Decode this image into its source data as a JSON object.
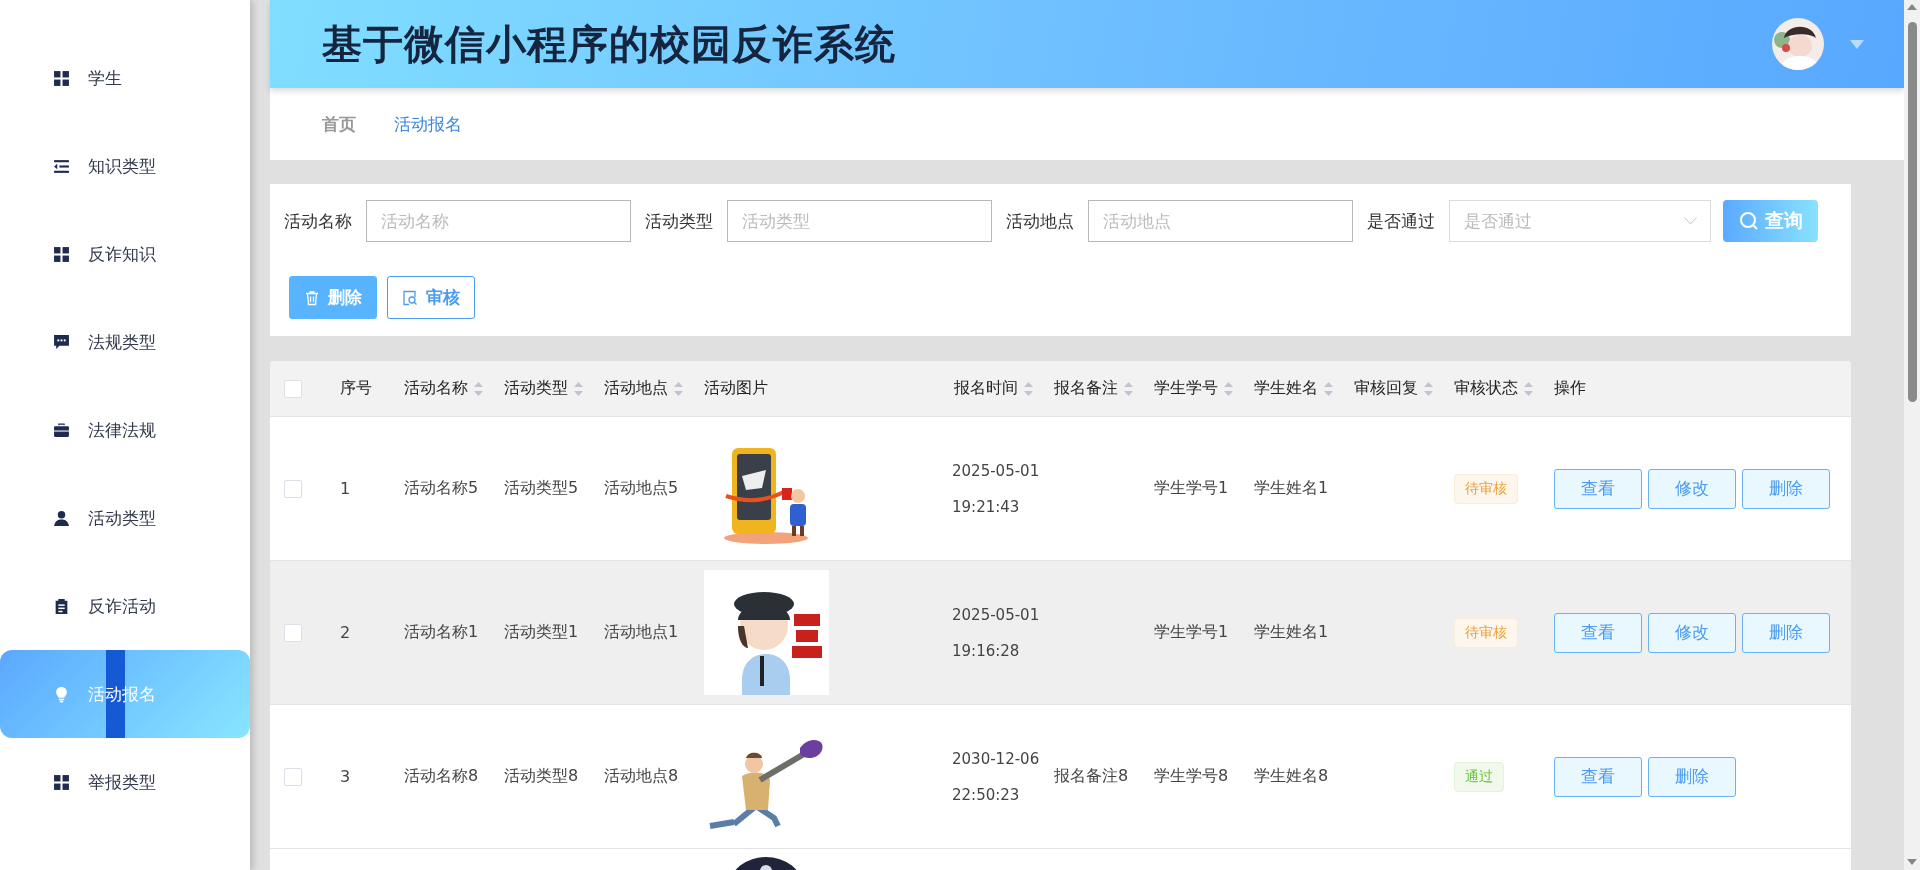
{
  "sidebar": {
    "items": [
      {
        "label": "学生",
        "selected": false
      },
      {
        "label": "知识类型",
        "selected": false
      },
      {
        "label": "反诈知识",
        "selected": false
      },
      {
        "label": "法规类型",
        "selected": false
      },
      {
        "label": "法律法规",
        "selected": false
      },
      {
        "label": "活动类型",
        "selected": false
      },
      {
        "label": "反诈活动",
        "selected": false
      },
      {
        "label": "活动报名",
        "selected": true
      },
      {
        "label": "举报类型",
        "selected": false
      }
    ]
  },
  "header": {
    "title": "基于微信小程序的校园反诈系统",
    "avatar": {
      "kind": "picture"
    }
  },
  "breadcrumb": [
    {
      "label": "首页",
      "selected": false
    },
    {
      "label": "活动报名",
      "selected": true
    }
  ],
  "search": {
    "fields": [
      {
        "label": "活动名称",
        "placeholder": "活动名称",
        "kind": "input"
      },
      {
        "label": "活动类型",
        "placeholder": "活动类型",
        "kind": "input"
      },
      {
        "label": "活动地点",
        "placeholder": "活动地点",
        "kind": "input"
      },
      {
        "label": "是否通过",
        "placeholder": "是否通过",
        "kind": "select"
      }
    ],
    "query_button": "查询"
  },
  "actions": [
    {
      "label": "删除",
      "kind": "filled"
    },
    {
      "label": "审核",
      "kind": "outline"
    }
  ],
  "table": {
    "select_all": {
      "checked": false
    },
    "columns": [
      {
        "label": "序号",
        "sortable": false
      },
      {
        "label": "活动名称",
        "sortable": true
      },
      {
        "label": "活动类型",
        "sortable": true
      },
      {
        "label": "活动地点",
        "sortable": true
      },
      {
        "label": "活动图片",
        "sortable": false
      },
      {
        "label": "报名时间",
        "sortable": true
      },
      {
        "label": "报名备注",
        "sortable": true
      },
      {
        "label": "学生学号",
        "sortable": true
      },
      {
        "label": "学生姓名",
        "sortable": true
      },
      {
        "label": "审核回复",
        "sortable": true
      },
      {
        "label": "审核状态",
        "sortable": true
      },
      {
        "label": "操作",
        "sortable": false
      }
    ],
    "rows": [
      {
        "checked": false,
        "hovered": false,
        "index": "1",
        "name": "活动名称5",
        "type": "活动类型5",
        "place": "活动地点5",
        "image": {
          "kind": "picture"
        },
        "time": "2025-05-01 19:21:43",
        "status": {
          "label": "待审核",
          "kind": "pending"
        },
        "student_id": "学生学号1",
        "student_name": "学生姓名1",
        "buttons": [
          "查看",
          "修改",
          "删除"
        ]
      },
      {
        "checked": false,
        "hovered": true,
        "index": "2",
        "name": "活动名称1",
        "type": "活动类型1",
        "place": "活动地点1",
        "image": {
          "kind": "picture"
        },
        "time": "2025-05-01 19:16:28",
        "status": {
          "label": "待审核",
          "kind": "pending"
        },
        "student_id": "学生学号1",
        "student_name": "学生姓名1",
        "buttons": [
          "查看",
          "修改",
          "删除"
        ]
      },
      {
        "checked": false,
        "hovered": false,
        "index": "3",
        "name": "活动名称8",
        "type": "活动类型8",
        "place": "活动地点8",
        "image": {
          "kind": "picture"
        },
        "time": "2030-12-06 22:50:23",
        "note": "报名备注8",
        "status": {
          "label": "通过",
          "kind": "passed"
        },
        "student_id": "学生学号8",
        "student_name": "学生姓名8",
        "buttons": [
          "查看",
          "删除"
        ]
      },
      {
        "hovered": false,
        "image": {
          "kind": "picture"
        }
      }
    ]
  }
}
